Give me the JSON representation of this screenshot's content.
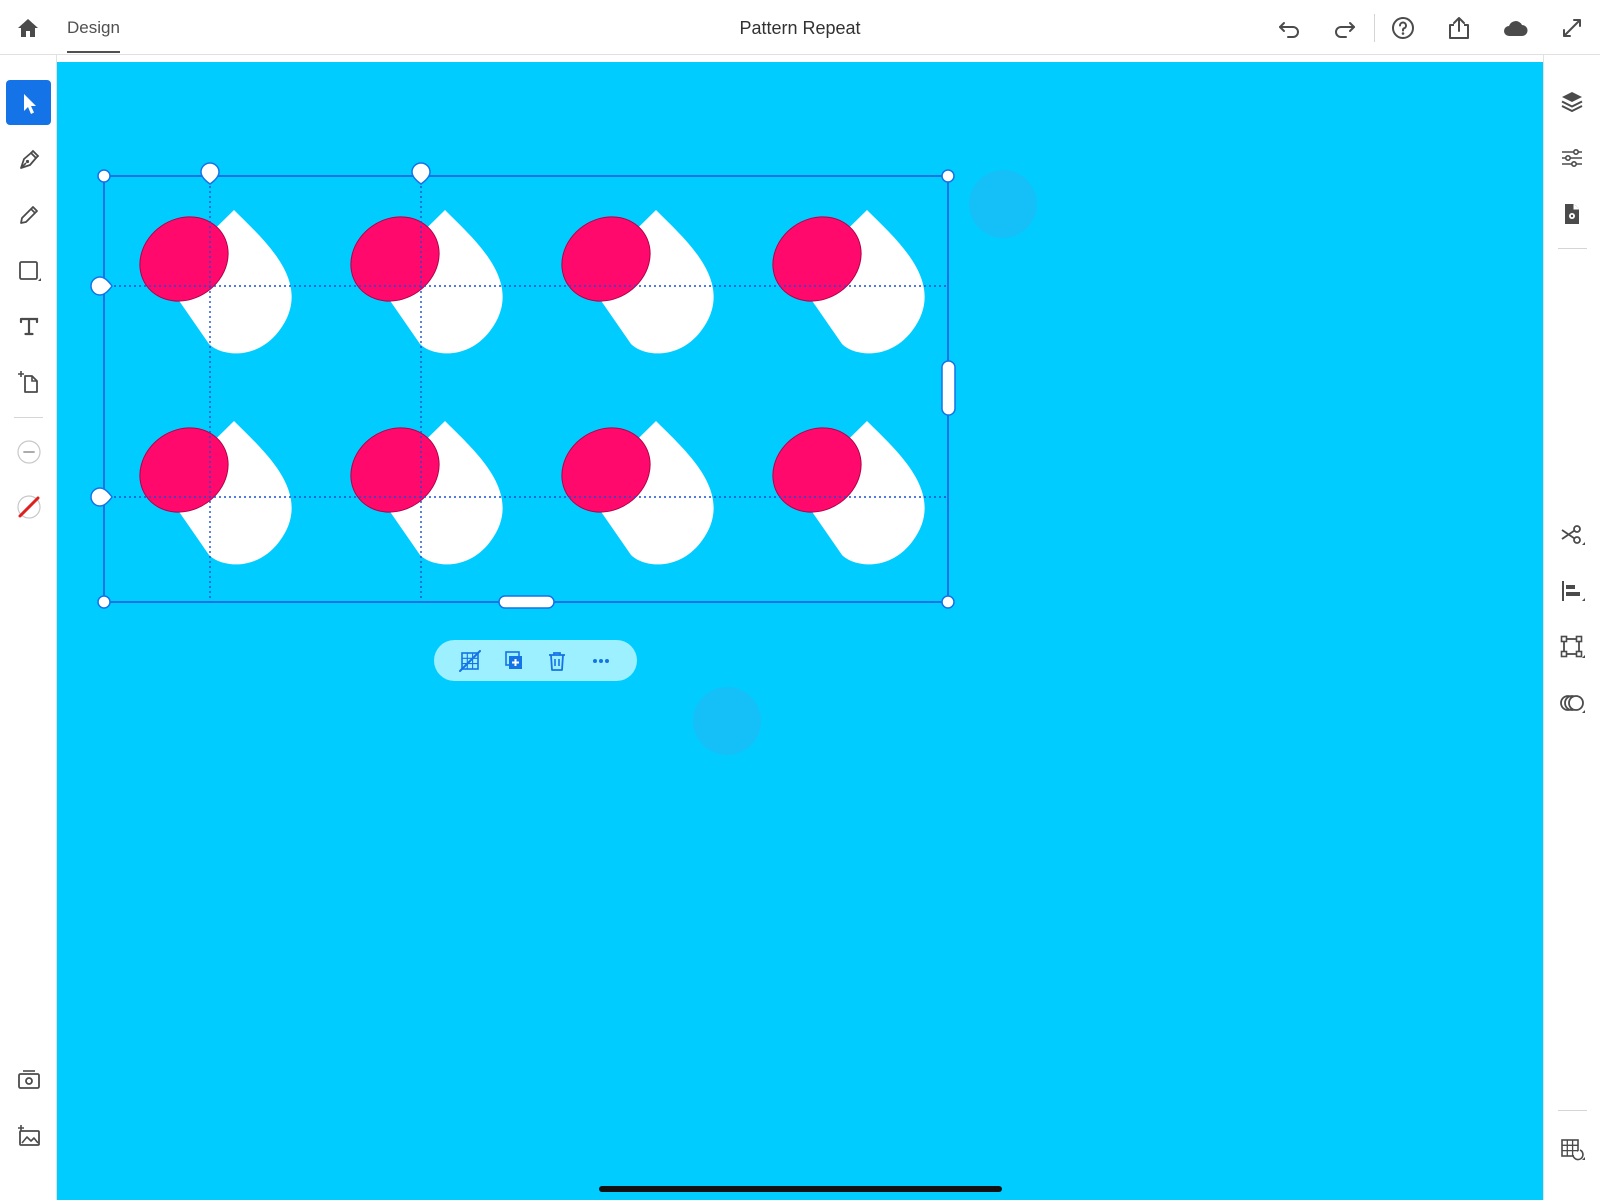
{
  "app": {
    "title": "Pattern Repeat",
    "tabs": [
      {
        "label": "Design",
        "active": true
      }
    ]
  },
  "topbar": {
    "icons": [
      "home-icon",
      "undo-icon",
      "redo-icon",
      "help-icon",
      "share-icon",
      "cloud-icon",
      "fullscreen-icon"
    ]
  },
  "left_toolbar": {
    "tools": [
      "select-tool",
      "pen-tool",
      "pencil-tool",
      "shape-tool",
      "text-tool",
      "place-file-tool"
    ],
    "active_tool": "select-tool",
    "stroke": "minus-stroke-icon",
    "fill": "no-fill-icon",
    "bottom": [
      "camera-icon",
      "add-image-icon"
    ]
  },
  "right_toolbar": {
    "top": [
      "layers-icon",
      "properties-icon",
      "document-settings-icon"
    ],
    "middle": [
      "cut-icon",
      "align-icon",
      "transform-icon",
      "combine-shapes-icon"
    ],
    "bottom": [
      "repeat-grid-icon"
    ]
  },
  "canvas": {
    "background": "#00ccff",
    "pattern": {
      "type": "repeat-grid",
      "rows": 2,
      "columns": 4,
      "cap_color": "#ff0a6c",
      "body_color": "#ffffff",
      "selection_color": "#1473e6"
    },
    "context_menu": [
      "release-repeat-icon",
      "duplicate-icon",
      "delete-icon",
      "more-icon"
    ]
  },
  "colors": {
    "accent": "#1473e6",
    "canvas": "#00ccff",
    "pill": "#9df0ff",
    "magenta": "#ff0a6c"
  }
}
